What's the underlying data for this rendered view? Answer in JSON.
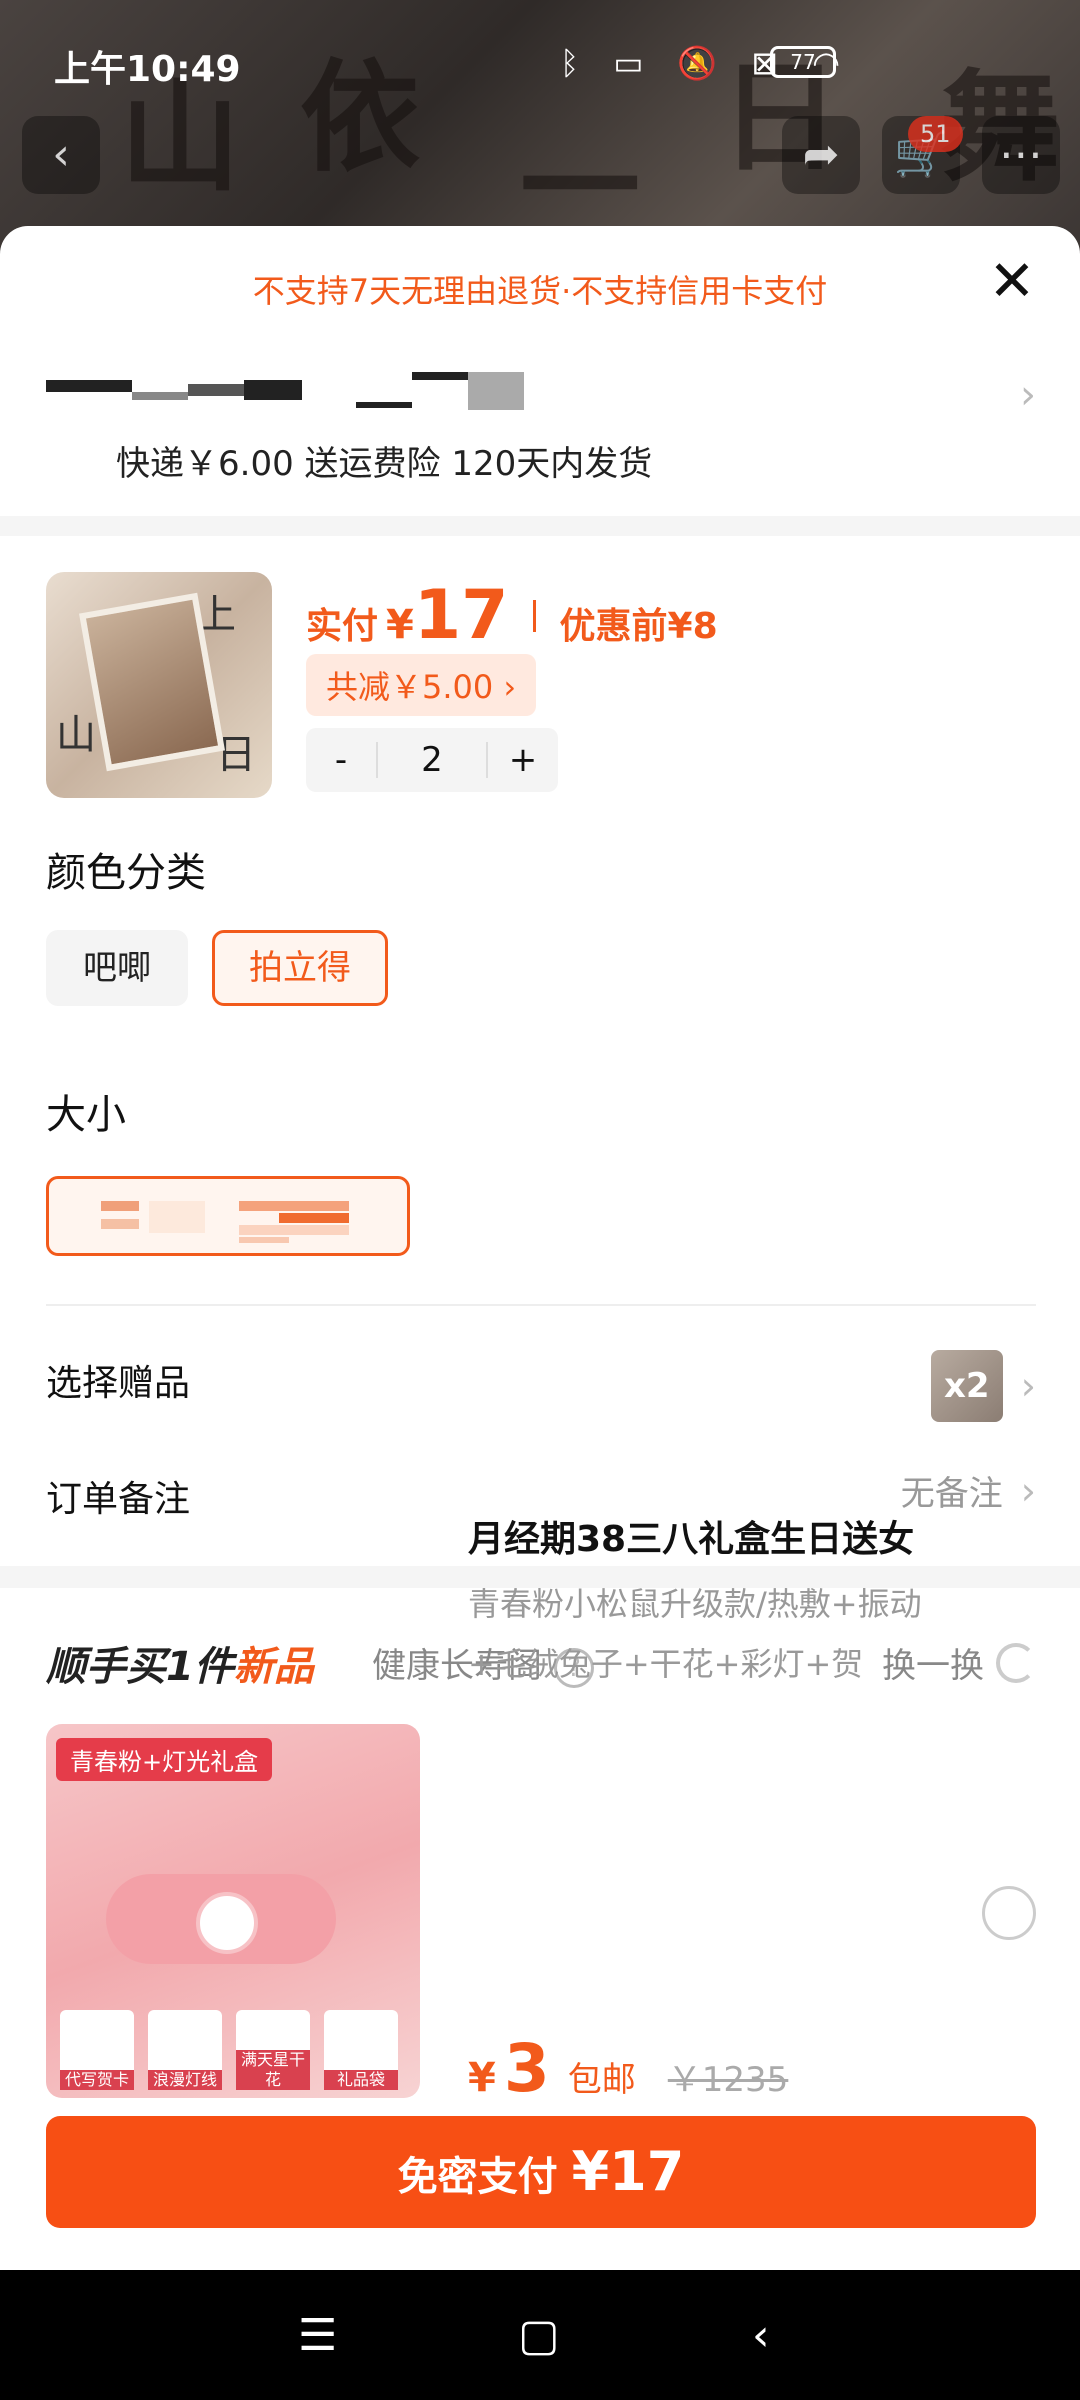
{
  "status_bar": {
    "time": "上午10:49",
    "battery": "77"
  },
  "background": {
    "cart_count": "51"
  },
  "sheet": {
    "notice": "不支持7天无理由退货·不支持信用卡支付",
    "close_icon": "close-icon",
    "shipping": "快递￥6.00 送运费险 120天内发货"
  },
  "product": {
    "paid_label": "实付",
    "currency": "¥",
    "paid_amount": "17",
    "orig_label": "优惠前",
    "orig_price": "¥8",
    "discount": "共减￥5.00 ›",
    "qty_minus": "-",
    "quantity": "2",
    "qty_plus": "+"
  },
  "color_section": {
    "title": "颜色分类",
    "options": [
      "吧唧",
      "拍立得"
    ],
    "selected": "拍立得"
  },
  "size_section": {
    "title": "大小"
  },
  "gift_row": {
    "label": "选择赠品",
    "badge": "x2"
  },
  "note_row": {
    "label": "订单备注",
    "value": "无备注"
  },
  "recommend": {
    "title": "顺手买1件",
    "title_new": "新品",
    "shop": "健康长寿阁",
    "swap": "换一换",
    "img_tag": "青春粉+灯光礼盒",
    "mini_labels": [
      "代写贺卡",
      "浪漫灯线",
      "满天星干花",
      "礼品袋"
    ],
    "name": "月经期38三八礼盒生日送女",
    "desc": "青春粉小松鼠升级款/热敷+振动+毛绒兔子+干花+彩灯+贺",
    "price_currency": "¥",
    "price": "3",
    "free_ship": "包邮",
    "old_price": "￥1235"
  },
  "pay_button": {
    "label": "免密支付 ",
    "amount": "¥17"
  },
  "colors": {
    "accent": "#f25a1b",
    "pay_button": "#f74f14"
  }
}
